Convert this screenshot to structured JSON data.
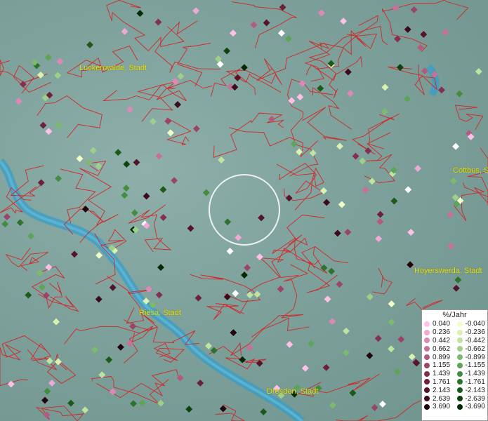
{
  "map": {
    "cities": [
      "Luckenwalde, Stadt",
      "Cottbus, S",
      "Hoyerswerda, Stadt",
      "Riesa, Stadt",
      "Dresden, Stadt"
    ],
    "legend_title": "%/Jahr",
    "legend_positive": [
      {
        "label": "0.040",
        "color": "#ffc0e8"
      },
      {
        "label": "0.236",
        "color": "#f0a8d4"
      },
      {
        "label": "0.442",
        "color": "#de88b8"
      },
      {
        "label": "0.662",
        "color": "#c8709a"
      },
      {
        "label": "0.899",
        "color": "#b45a80"
      },
      {
        "label": "1.155",
        "color": "#9c4468"
      },
      {
        "label": "1.439",
        "color": "#843050"
      },
      {
        "label": "1.761",
        "color": "#6c203c"
      },
      {
        "label": "2.143",
        "color": "#54142a"
      },
      {
        "label": "2.639",
        "color": "#3c0a1a"
      },
      {
        "label": "3.690",
        "color": "#24040c"
      }
    ],
    "legend_negative": [
      {
        "label": "-0.040",
        "color": "#f2ffc8"
      },
      {
        "label": "-0.236",
        "color": "#daf2b0"
      },
      {
        "label": "-0.442",
        "color": "#bfe4a0"
      },
      {
        "label": "-0.662",
        "color": "#9ed08a"
      },
      {
        "label": "-0.899",
        "color": "#7cba6e"
      },
      {
        "label": "-1.155",
        "color": "#5ea456"
      },
      {
        "label": "-1.439",
        "color": "#448c40"
      },
      {
        "label": "-1.761",
        "color": "#2e722e"
      },
      {
        "label": "-2.143",
        "color": "#1c5a1c"
      },
      {
        "label": "-2.639",
        "color": "#0e420e"
      },
      {
        "label": "-3.690",
        "color": "#042a04"
      }
    ],
    "colors": {
      "boundary": "#d02828",
      "river": "#3a9ec8",
      "background": "#7fa29c",
      "city_label": "#e6e600",
      "selection_ring": "#ffffff"
    }
  }
}
